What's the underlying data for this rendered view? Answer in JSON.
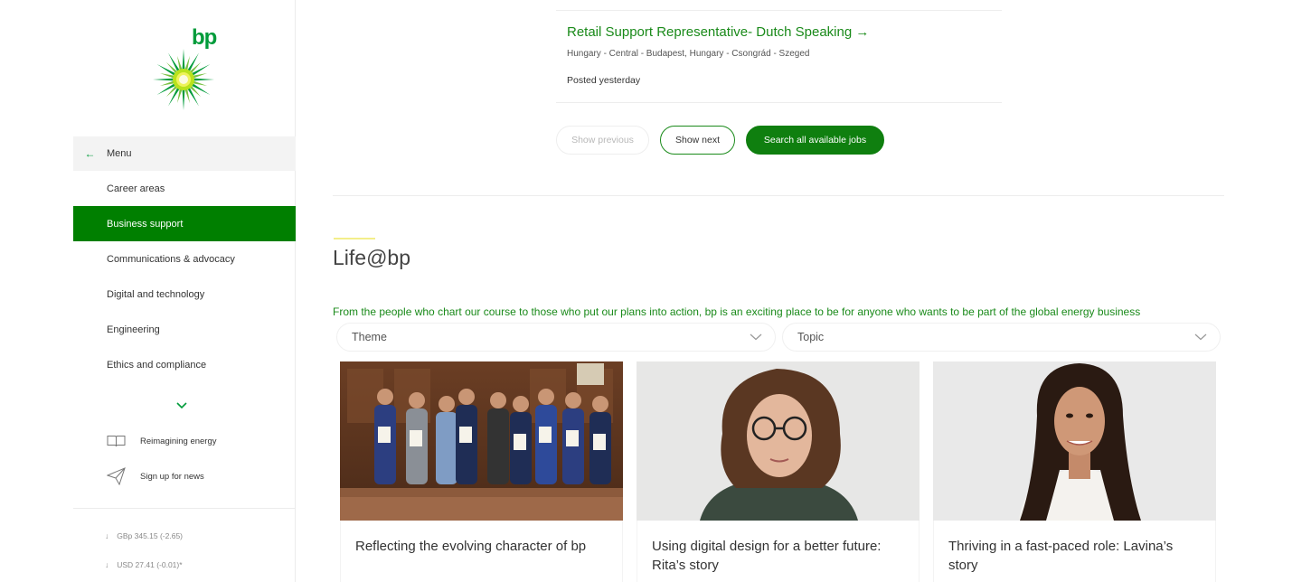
{
  "brand": {
    "logo_text": "bp",
    "accent": "#009b3a",
    "active_green": "#007f00"
  },
  "sidebar": {
    "menu_label": "Menu",
    "items": [
      {
        "label": "Career areas",
        "active": false
      },
      {
        "label": "Business support",
        "active": true
      },
      {
        "label": "Communications & advocacy",
        "active": false
      },
      {
        "label": "Digital and technology",
        "active": false
      },
      {
        "label": "Engineering",
        "active": false
      },
      {
        "label": "Ethics and compliance",
        "active": false
      }
    ],
    "links": [
      {
        "label": "Reimagining energy",
        "icon": "book-icon"
      },
      {
        "label": "Sign up for news",
        "icon": "paper-plane-icon"
      }
    ],
    "stocks": [
      {
        "text": "GBp 345.15 (-2.65)"
      },
      {
        "text": "USD 27.41 (-0.01)*"
      }
    ]
  },
  "job": {
    "title": "Retail Support Representative- Dutch Speaking →",
    "location": "Hungary - Central - Budapest, Hungary - Csongrád - Szeged",
    "posted": "Posted yesterday"
  },
  "pager": {
    "prev_label": "Show previous",
    "next_label": "Show next",
    "search_label": "Search all available jobs"
  },
  "life": {
    "title": "Life@bp",
    "intro": "From the people who chart our course to those who put our plans into action, bp is an exciting place to be for anyone who wants to be part of the global energy business",
    "filters": {
      "theme": "Theme",
      "topic": "Topic"
    },
    "cards": [
      {
        "caption": "Reflecting the evolving character of bp"
      },
      {
        "caption": "Using digital design for a better future: Rita’s story"
      },
      {
        "caption": "Thriving in a fast-paced role: Lavina’s story"
      }
    ]
  }
}
